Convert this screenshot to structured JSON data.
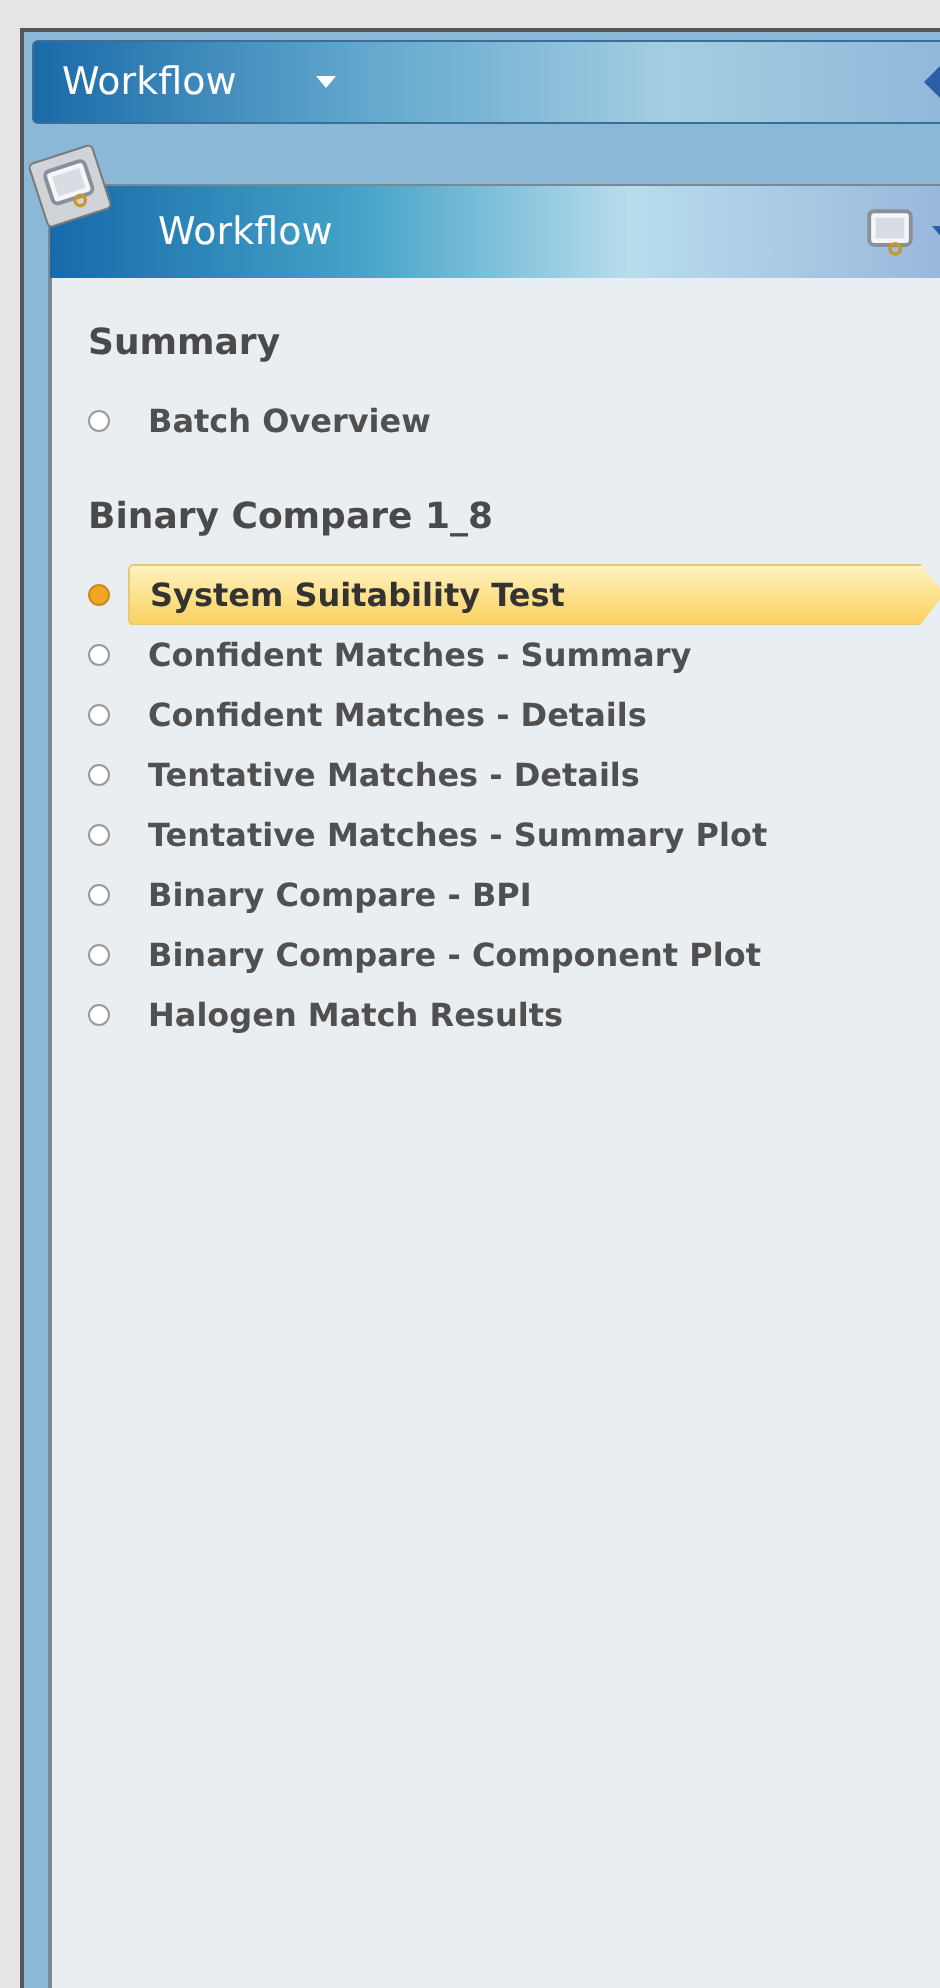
{
  "top_bar": {
    "title": "Workflow"
  },
  "panel": {
    "title": "Workflow"
  },
  "groups": [
    {
      "title": "Summary",
      "items": [
        {
          "label": "Batch Overview",
          "selected": false
        }
      ]
    },
    {
      "title": "Binary Compare 1_8",
      "items": [
        {
          "label": "System Suitability Test",
          "selected": true
        },
        {
          "label": "Confident Matches - Summary",
          "selected": false
        },
        {
          "label": "Confident Matches - Details",
          "selected": false
        },
        {
          "label": "Tentative Matches - Details",
          "selected": false
        },
        {
          "label": "Tentative Matches - Summary Plot",
          "selected": false
        },
        {
          "label": "Binary Compare - BPI",
          "selected": false
        },
        {
          "label": "Binary Compare - Component Plot",
          "selected": false
        },
        {
          "label": "Halogen Match Results",
          "selected": false
        }
      ]
    }
  ]
}
